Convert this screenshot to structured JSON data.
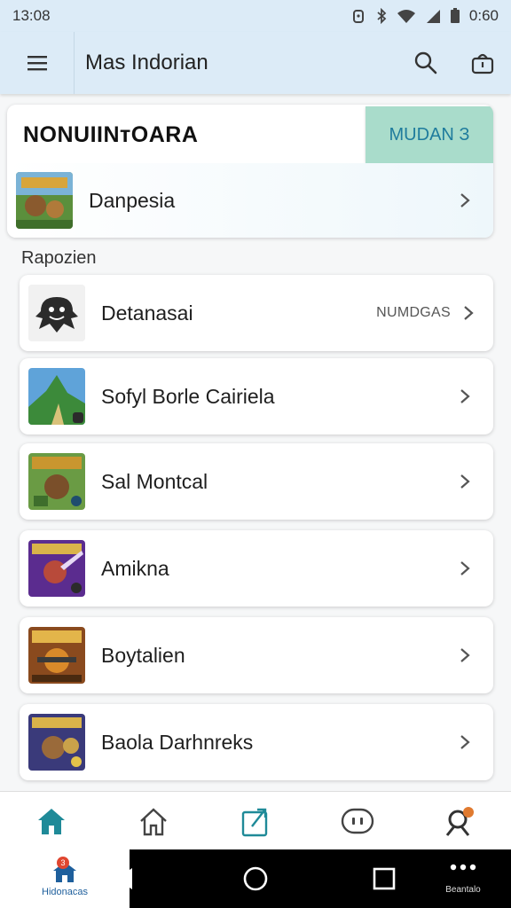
{
  "status": {
    "time": "13:08",
    "battery": "0:60"
  },
  "appbar": {
    "title": "Mas Indorian"
  },
  "featured": {
    "heading": "NONUIINтOARA",
    "action_label": "MUDAN З",
    "item_label": "Danpesia"
  },
  "section_label": "Rapozien",
  "items": [
    {
      "label": "Detanasai",
      "meta": "NUMDGAS"
    },
    {
      "label": "Sofyl Borle Cairiela"
    },
    {
      "label": "Sal Montcal"
    },
    {
      "label": "Amikna"
    },
    {
      "label": "Boytalien"
    },
    {
      "label": "Baola Darhnreks"
    }
  ],
  "bottom_nav": [
    "home-filled-icon",
    "home-outline-icon",
    "share-box-icon",
    "chat-bubble-icon",
    "profile-badge-icon"
  ],
  "sysbar": {
    "left_caption": "Hidonacas",
    "badge": "3",
    "right_caption": "Beantalo"
  },
  "colors": {
    "header_bg": "#dcebf7",
    "accent_teal": "#1f8a98",
    "action_bg": "#a9dccb"
  }
}
